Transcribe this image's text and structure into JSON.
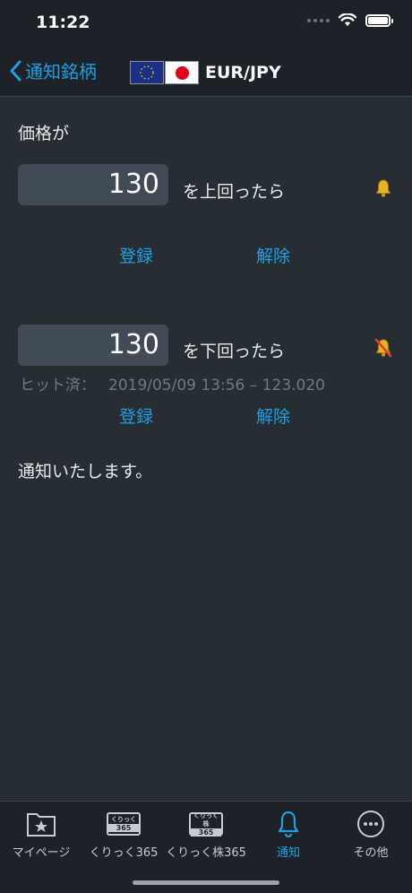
{
  "status": {
    "time": "11:22"
  },
  "nav": {
    "back_label": "通知銘柄",
    "pair": "EUR/JPY"
  },
  "intro_text": "価格が",
  "alerts": [
    {
      "price": "130",
      "condition": "を上回ったら",
      "bell_state": "bell-on",
      "register_label": "登録",
      "cancel_label": "解除"
    },
    {
      "price": "130",
      "condition": "を下回ったら",
      "bell_state": "bell-off",
      "hit_label": "ヒット済：",
      "hit_value": "2019/05/09 13:56 – 123.020",
      "register_label": "登録",
      "cancel_label": "解除"
    }
  ],
  "outro_text": "通知いたします。",
  "tabs": [
    {
      "label": "マイページ",
      "icon": "star-folder-icon"
    },
    {
      "label": "くりっく365",
      "icon": "kurikku365-icon",
      "badge_top": "くりっく",
      "badge_num": "365"
    },
    {
      "label": "くりっく株365",
      "icon": "kurikku-kabu365-icon",
      "badge_top": "くりっく株",
      "badge_num": "365"
    },
    {
      "label": "通知",
      "icon": "bell-icon",
      "active": true
    },
    {
      "label": "その他",
      "icon": "more-icon"
    }
  ],
  "colors": {
    "accent": "#1ea0e6",
    "background": "#262d33",
    "bar": "#1c2227",
    "input": "#414b55",
    "muted": "#6f7a83"
  }
}
